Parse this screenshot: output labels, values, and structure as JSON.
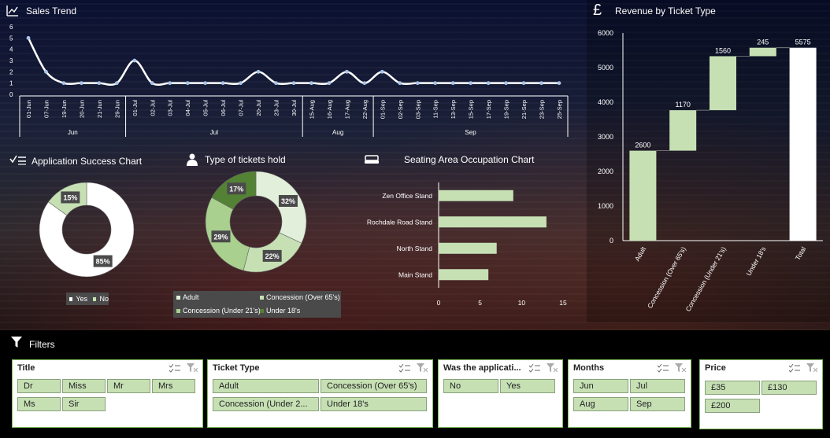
{
  "sales_trend": {
    "title": "Sales Trend",
    "y_ticks": [
      "6",
      "5",
      "4",
      "3",
      "2",
      "1",
      "0"
    ]
  },
  "revenue": {
    "title": "Revenue by Ticket Type",
    "y_ticks": [
      "6000",
      "5000",
      "4000",
      "3000",
      "2000",
      "1000",
      "0"
    ]
  },
  "app_success": {
    "title": "Application Success Chart",
    "legend": [
      "Yes",
      "No"
    ]
  },
  "tickets_hold": {
    "title": "Type of tickets hold",
    "legend": [
      "Adult",
      "Concession (Over 65's)",
      "Concession (Under 21's)",
      "Under 18's"
    ]
  },
  "seating": {
    "title": "Seating Area Occupation Chart",
    "x_ticks": [
      "0",
      "5",
      "10",
      "15"
    ]
  },
  "filters": {
    "label": "Filters",
    "title_slicer": {
      "header": "Title",
      "items": [
        "Dr",
        "Miss",
        "Mr",
        "Mrs",
        "Ms",
        "Sir"
      ]
    },
    "ticket_slicer": {
      "header": "Ticket Type",
      "items": [
        "Adult",
        "Concession (Over 65's)",
        "Concession (Under 2...",
        "Under 18's"
      ]
    },
    "app_slicer": {
      "header": "Was the applicati...",
      "items": [
        "No",
        "Yes"
      ]
    },
    "months_slicer": {
      "header": "Months",
      "items": [
        "Jun",
        "Jul",
        "Aug",
        "Sep"
      ]
    },
    "price_slicer": {
      "header": "Price",
      "items": [
        "£35",
        "£130",
        "£200"
      ]
    }
  },
  "chart_data": [
    {
      "type": "line",
      "title": "Sales Trend",
      "x": [
        "01-Jun",
        "07-Jun",
        "19-Jun",
        "20-Jun",
        "21-Jun",
        "29-Jun",
        "01-Jul",
        "02-Jul",
        "03-Jul",
        "04-Jul",
        "05-Jul",
        "06-Jul",
        "07-Jul",
        "20-Jul",
        "23-Jul",
        "30-Jul",
        "15-Aug",
        "16-Aug",
        "17-Aug",
        "22-Aug",
        "01-Sep",
        "02-Sep",
        "03-Sep",
        "11-Sep",
        "13-Sep",
        "15-Sep",
        "17-Sep",
        "19-Sep",
        "21-Sep",
        "23-Sep",
        "25-Sep"
      ],
      "month_groups": [
        {
          "name": "Jun",
          "count": 6
        },
        {
          "name": "Jul",
          "count": 10
        },
        {
          "name": "Aug",
          "count": 4
        },
        {
          "name": "Sep",
          "count": 11
        }
      ],
      "values": [
        5,
        2,
        1,
        1,
        1,
        1,
        3,
        1,
        1,
        1,
        1,
        1,
        1,
        2,
        1,
        1,
        1,
        1,
        2,
        1,
        2,
        1,
        1,
        1,
        1,
        1,
        1,
        1,
        1,
        1,
        1
      ],
      "ylim": [
        0,
        6
      ],
      "color": "#ffffff",
      "point_color": "#a9c4ea"
    },
    {
      "type": "bar",
      "subtype": "waterfall",
      "title": "Revenue by Ticket Type",
      "categories": [
        "Adult",
        "Concession (Over 65's)",
        "Concession (Under 21's)",
        "Under 18's",
        "Total"
      ],
      "values": [
        2600,
        1170,
        1560,
        245,
        5575
      ],
      "ylim": [
        0,
        6000
      ],
      "colors": [
        "#c6e0b4",
        "#c6e0b4",
        "#c6e0b4",
        "#c6e0b4",
        "#ffffff"
      ]
    },
    {
      "type": "pie",
      "subtype": "donut",
      "title": "Application Success Chart",
      "categories": [
        "Yes",
        "No"
      ],
      "values": [
        85,
        15
      ],
      "labels": [
        "85%",
        "15%"
      ],
      "colors": [
        "#ffffff",
        "#c6e0b4"
      ]
    },
    {
      "type": "pie",
      "subtype": "donut",
      "title": "Type of tickets hold",
      "categories": [
        "Adult",
        "Concession (Over 65's)",
        "Concession (Under 21's)",
        "Under 18's"
      ],
      "values": [
        32,
        22,
        29,
        17
      ],
      "labels": [
        "32%",
        "22%",
        "29%",
        "17%"
      ],
      "colors": [
        "#e2efda",
        "#c6e0b4",
        "#a9d08e",
        "#548235"
      ]
    },
    {
      "type": "bar",
      "orientation": "horizontal",
      "title": "Seating Area Occupation Chart",
      "categories": [
        "Zen Office Stand",
        "Rochdale Road Stand",
        "North Stand",
        "Main Stand"
      ],
      "values": [
        9,
        13,
        7,
        6
      ],
      "xlim": [
        0,
        15
      ],
      "color": "#c6e0b4"
    }
  ]
}
